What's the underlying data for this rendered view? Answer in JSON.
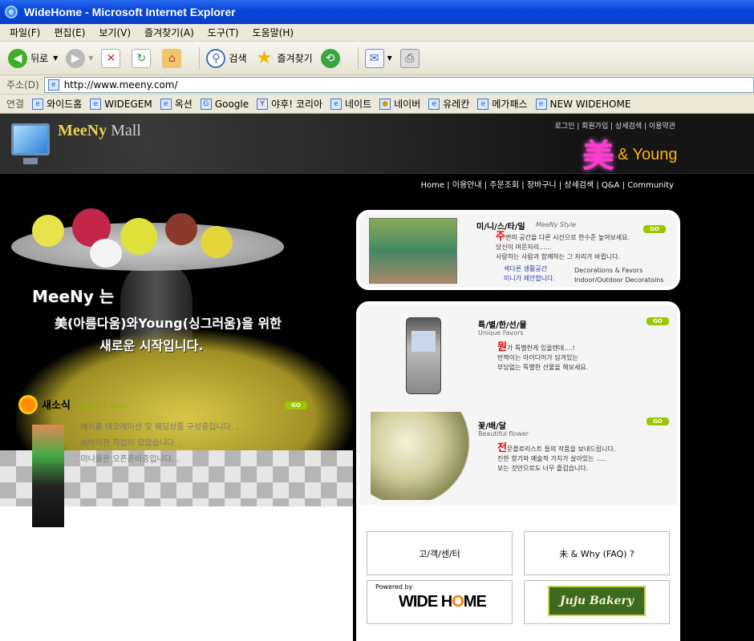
{
  "window": {
    "title": "WideHome - Microsoft Internet Explorer"
  },
  "menu": [
    "파일(F)",
    "편집(E)",
    "보기(V)",
    "즐겨찾기(A)",
    "도구(T)",
    "도움말(H)"
  ],
  "toolbar": {
    "back": "뒤로",
    "search": "검색",
    "favorites": "즐겨찾기"
  },
  "address": {
    "label": "주소(D)",
    "url": "http://www.meeny.com/"
  },
  "links": {
    "label": "연결",
    "items": [
      "와이드홈",
      "WIDEGEM",
      "옥션",
      "Google",
      "야후! 코리아",
      "네이트",
      "네이버",
      "유레칸",
      "메가패스",
      "NEW WIDEHOME"
    ]
  },
  "site": {
    "brand": "MeeNy",
    "brand_mall": "Mall",
    "top_nav": "로그인 | 회원가입 | 상세검색 | 이용약관",
    "logo_han": "美",
    "logo_young": "& Young",
    "main_nav": "Home | 이용안내 | 주문조회 | 장바구니 | 상세검색 | Q&A | Community",
    "slogan1": "MeeNy 는",
    "slogan2": "美(아름다움)와Young(싱그러움)을 위한",
    "slogan3": "새로운 시작입니다.",
    "news": {
      "title": "새소식",
      "subtitle": "Notice & News",
      "go": "GO",
      "lines": [
        ". 예식홀 데코레이션 및 웨딩상품 구성중입니다. .",
        ". 서버이전 작업이 있었습니다. .",
        ". 미니몰은 오픈준비중입니다. ."
      ]
    },
    "ministyle": {
      "title": "미/니/스/타/일",
      "sub": "MeeNy Style",
      "go": "GO",
      "lead": "주",
      "line1": "변의 공간을 다른 시선으로 한수준 높여보세요.",
      "line2": "당신이 머문자리......",
      "line3": "사랑하는 사람과 함께하는 그 자리가 바뀝니다.",
      "blue1": "색다른 생활공간",
      "blue2": "미니가 제안합니다.",
      "eng1": "Decorations & Favors",
      "eng2": "Indoor/Outdoor Decoratoins"
    },
    "favors": {
      "title": "특/별/한/선/물",
      "sub": "Unique Favors",
      "go": "GO",
      "lead": "뭔",
      "line1": "가 특별한게 있을텐데....!",
      "line2": "반짝이는 아이디어가 담겨있는",
      "line3": "부담없는 특별한 선물을 해보세요."
    },
    "flower": {
      "title": "꽃/배/달",
      "sub": "Beautiful flower",
      "go": "GO",
      "lead": "전",
      "line1": "문플로리스트 들의 작품을 보내드립니다.",
      "line2": "진한 향기와 예술적 가치가 살아있는 .....",
      "line3": "보는 것만으로도 너무 즐겁습니다."
    },
    "customer": "고/객/센/터",
    "faq": "未 & Why (FAQ) ?",
    "powered": "Powered by",
    "widehome_a": "WIDE H",
    "widehome_o": "O",
    "widehome_b": "ME",
    "juju": "Juju Bakery"
  }
}
